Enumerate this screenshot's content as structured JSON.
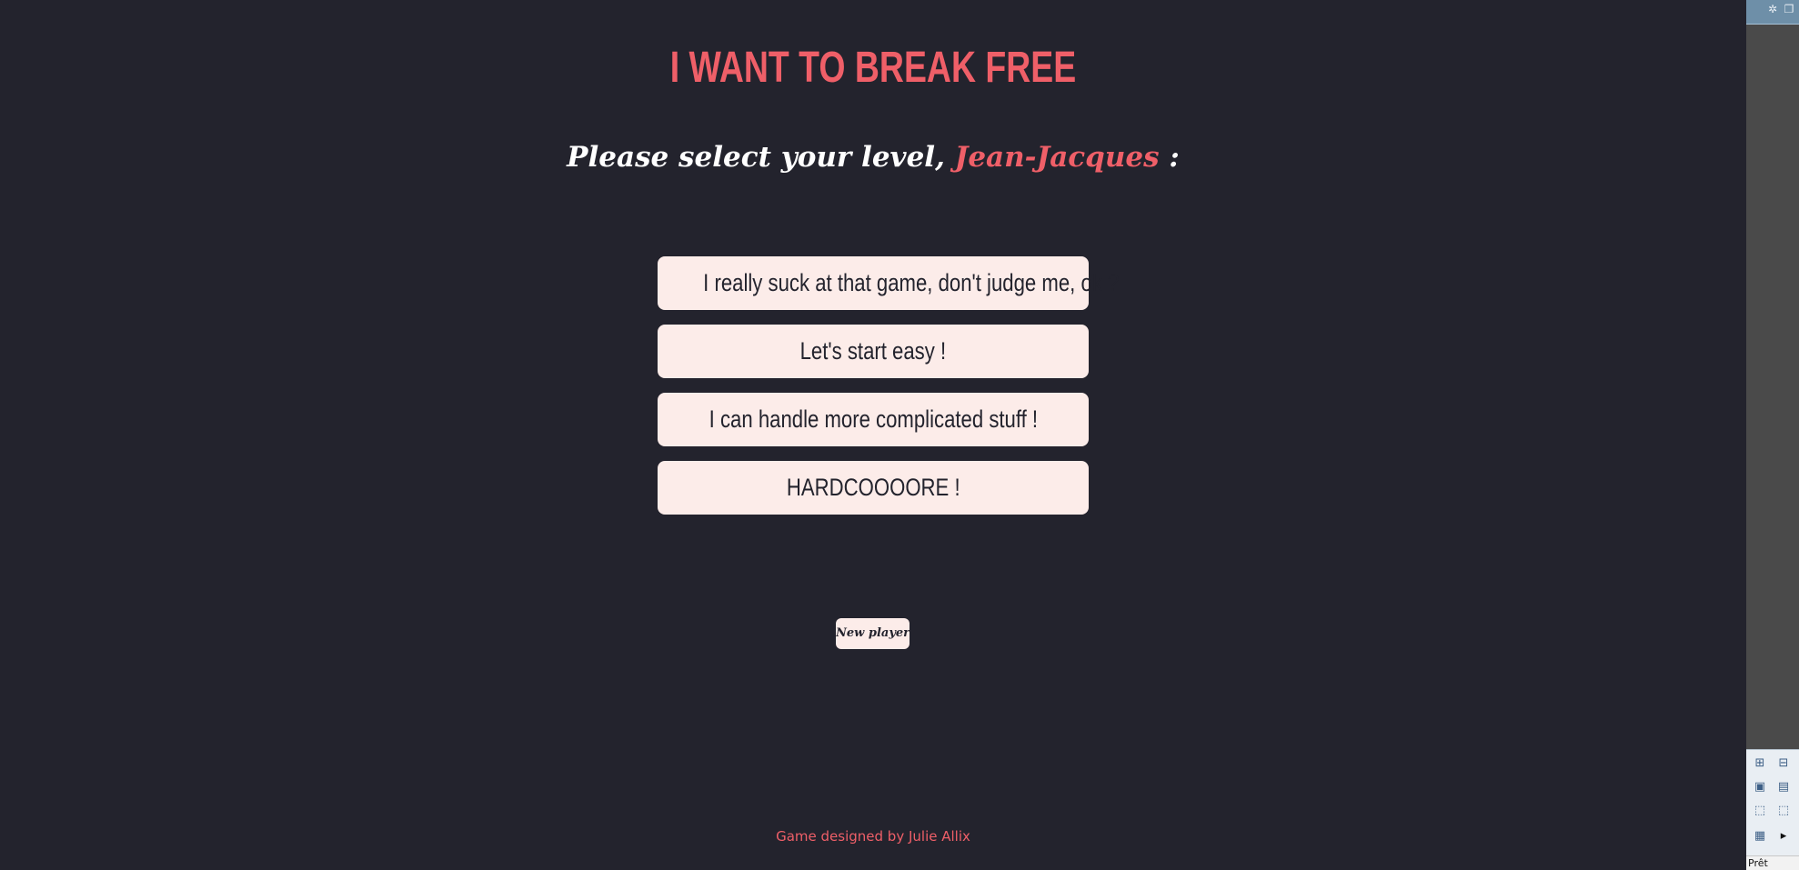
{
  "game": {
    "title": "I WANT TO BREAK FREE",
    "prompt_before": "Please select your level, ",
    "player_name": "Jean-Jacques",
    "prompt_after": " :",
    "levels": [
      {
        "label": "I really suck at that game, don't judge me, ok ?"
      },
      {
        "label": "Let's start easy !"
      },
      {
        "label": "I can handle more complicated stuff !"
      },
      {
        "label": "HARDCOOOORE !"
      }
    ],
    "new_player_label": "New player",
    "footer": "Game designed by Julie Allix"
  },
  "side_panel": {
    "status": "Prêt",
    "toolbar_icons": [
      "minimize-icon",
      "restore-icon"
    ],
    "palette_icons": [
      "tree-node-icon",
      "tree-node-add-icon",
      "tree-folder-icon",
      "tree-database-icon",
      "tree-select-icon",
      "tree-select-alt-icon",
      "tree-grid-icon",
      "play-arrow-icon"
    ]
  },
  "colors": {
    "background": "#23232d",
    "accent": "#ef5f68",
    "button_bg": "#fcece9",
    "text_light": "#ffffff"
  }
}
